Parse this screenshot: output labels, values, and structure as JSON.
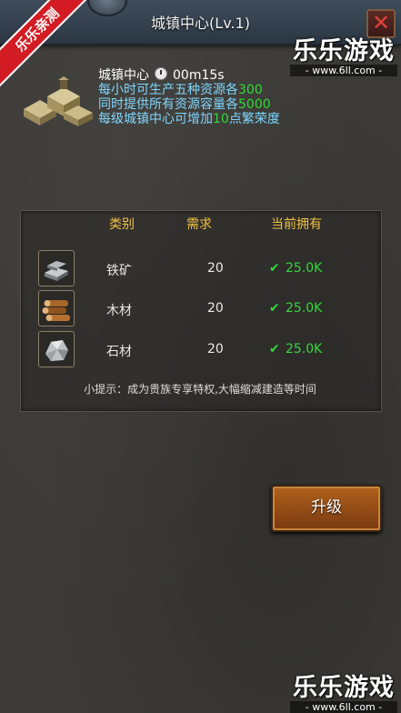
{
  "window": {
    "title": "城镇中心(Lv.1)"
  },
  "watermark": {
    "ribbon": "乐乐亲测",
    "logo": "乐乐游戏",
    "url": "- www.6ll.com -"
  },
  "building": {
    "name": "城镇中心",
    "timer": "00m15s",
    "line1_pre": "每小时可生产五种资源各",
    "line1_val": "300",
    "line2_pre": "同时提供所有资源容量各",
    "line2_val": "5000",
    "line3_pre": "每级城镇中心可增加",
    "line3_val": "10",
    "line3_post": "点繁荣度"
  },
  "table": {
    "headers": {
      "category": "类别",
      "required": "需求",
      "owned": "当前拥有"
    },
    "rows": [
      {
        "icon": "iron-ore-icon",
        "name": "铁矿",
        "required": "20",
        "owned": "25.0K"
      },
      {
        "icon": "wood-icon",
        "name": "木材",
        "required": "20",
        "owned": "25.0K"
      },
      {
        "icon": "stone-icon",
        "name": "石材",
        "required": "20",
        "owned": "25.0K"
      }
    ],
    "tip": "小提示：成为贵族专享特权,大幅缩减建造等时间"
  },
  "actions": {
    "upgrade": "升级"
  },
  "colors": {
    "accent_green": "#32d93a",
    "header_gold": "#f1c040",
    "info_blue": "#7fd6ff"
  }
}
